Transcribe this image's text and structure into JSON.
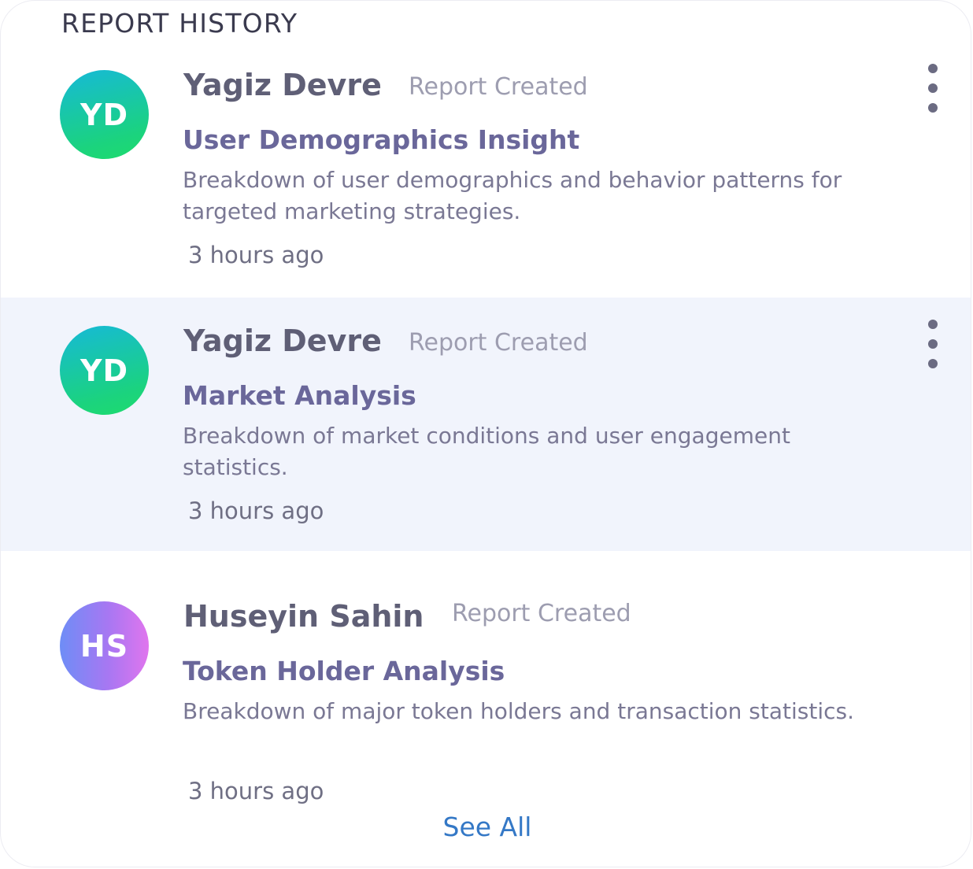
{
  "panel": {
    "title": "REPORT HISTORY",
    "see_all_label": "See All"
  },
  "entries": [
    {
      "initials": "YD",
      "author": "Yagiz Devre",
      "action": "Report Created",
      "report_title": "User Demographics Insight",
      "description": "Breakdown of user demographics and behavior patterns for targeted marketing strategies.",
      "time": "3 hours ago",
      "avatar_style": "teal-green-gradient",
      "menu_icon": "more-vertical-icon"
    },
    {
      "initials": "YD",
      "author": "Yagiz Devre",
      "action": "Report Created",
      "report_title": "Market Analysis",
      "description": "Breakdown of market conditions and user engagement statistics.",
      "time": "3 hours ago",
      "avatar_style": "teal-green-gradient",
      "menu_icon": "more-vertical-icon",
      "highlighted": true
    },
    {
      "initials": "HS",
      "author": "Huseyin Sahin",
      "action": "Report Created",
      "report_title": "Token Holder Analysis",
      "description": "Breakdown of major token holders and  transaction statistics.",
      "time": "3 hours ago",
      "avatar_style": "blue-purple-gradient"
    }
  ],
  "colors": {
    "highlight_row": "#f1f4fc",
    "link": "#3478c6",
    "title_purple": "#6a679a"
  }
}
